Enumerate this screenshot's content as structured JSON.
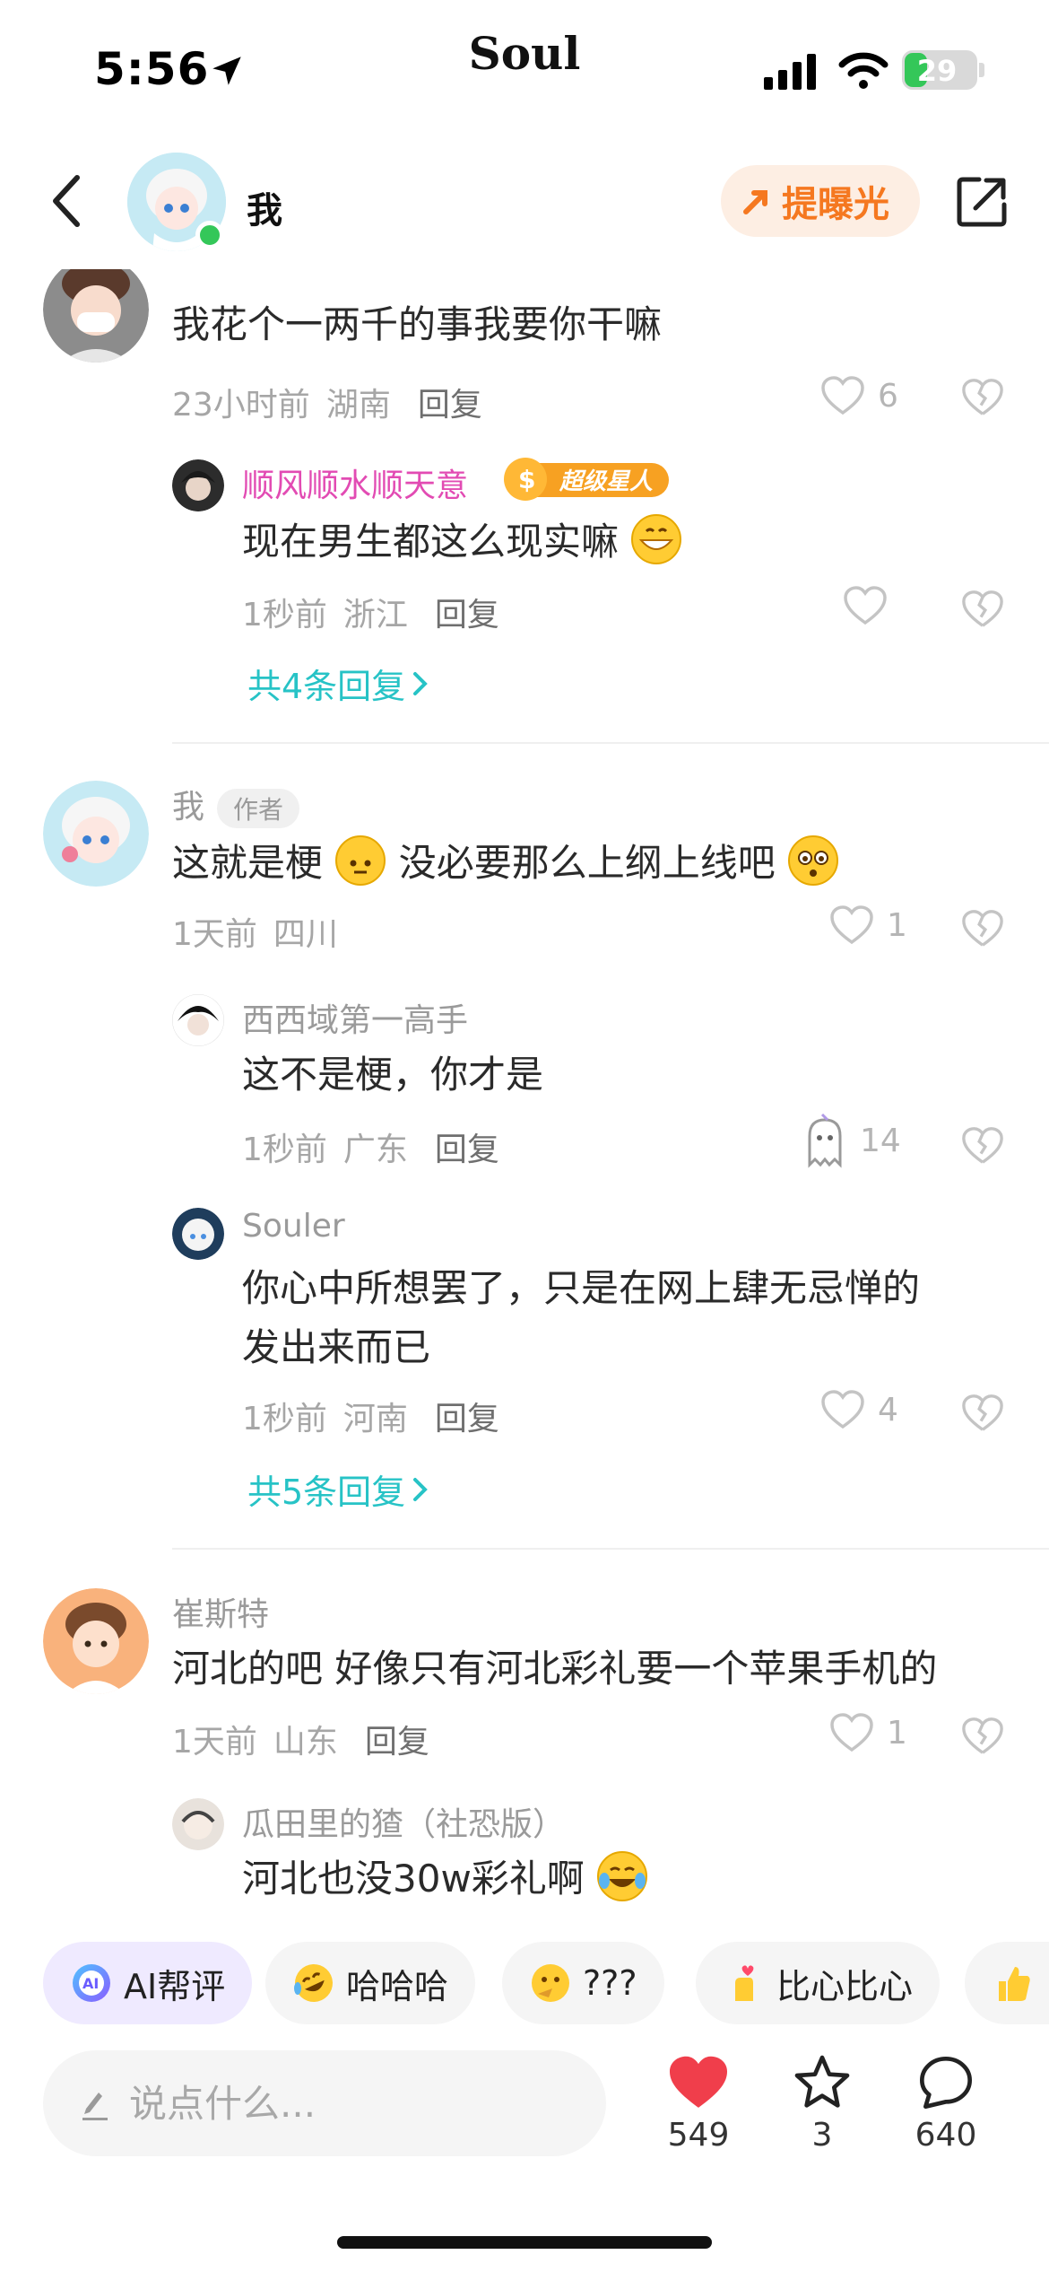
{
  "status_bar": {
    "time": "5:56",
    "carrier": "Soul",
    "battery": "29"
  },
  "nav": {
    "title": "我",
    "expose_label": "提曝光"
  },
  "comments": [
    {
      "user": "",
      "text": "我花个一两千的事我要你干嘛",
      "time": "23小时前",
      "region": "湖南",
      "reply_label": "回复",
      "likes": "6",
      "replies": [
        {
          "user": "顺风顺水顺天意",
          "badge": "超级星人",
          "text": "现在男生都这么现实嘛",
          "time": "1秒前",
          "region": "浙江",
          "reply_label": "回复",
          "likes": ""
        }
      ],
      "more_label": "共4条回复"
    },
    {
      "user": "我",
      "author_tag": "作者",
      "text_a": "这就是梗",
      "text_b": "没必要那么上纲上线吧",
      "time": "1天前",
      "region": "四川",
      "likes": "1",
      "replies": [
        {
          "user": "西西域第一高手",
          "text": "这不是梗，你才是",
          "time": "1秒前",
          "region": "广东",
          "reply_label": "回复",
          "likes": "14"
        },
        {
          "user": "Souler",
          "text_line1": "你心中所想罢了，只是在网上肆无忌惮的",
          "text_line2": "发出来而已",
          "time": "1秒前",
          "region": "河南",
          "reply_label": "回复",
          "likes": "4"
        }
      ],
      "more_label": "共5条回复"
    },
    {
      "user": "崔斯特",
      "text": "河北的吧  好像只有河北彩礼要一个苹果手机的",
      "time": "1天前",
      "region": "山东",
      "reply_label": "回复",
      "likes": "1",
      "replies": [
        {
          "user": "瓜田里的猹（社恐版）",
          "text": "河北也没30w彩礼啊"
        }
      ]
    }
  ],
  "quick_reactions": [
    {
      "label": "AI帮评",
      "icon": "ai-icon"
    },
    {
      "label": "哈哈哈",
      "icon": "rofl-emoji-icon"
    },
    {
      "label": "???",
      "icon": "thinking-emoji-icon"
    },
    {
      "label": "比心比心",
      "icon": "finger-heart-icon"
    }
  ],
  "input": {
    "placeholder": "说点什么..."
  },
  "actions": {
    "likes": "549",
    "favorites": "3",
    "comments": "640"
  },
  "colors": {
    "accent_teal": "#27c3c6",
    "like_red": "#f03e4b",
    "expose_orange": "#f57820",
    "vip_pink": "#e24bb3"
  }
}
